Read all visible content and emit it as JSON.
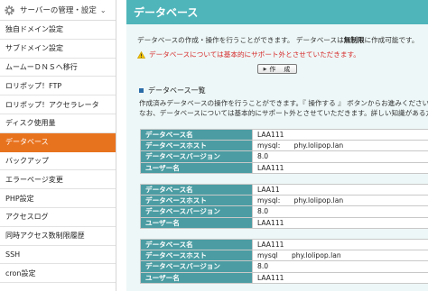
{
  "sidebar": {
    "header_title": "サーバーの管理・設定",
    "items": [
      {
        "label": "独自ドメイン設定"
      },
      {
        "label": "サブドメイン設定"
      },
      {
        "label": "ムームーＤＮＳへ移行"
      },
      {
        "label": "ロリポップ！FTP"
      },
      {
        "label": "ロリポップ！アクセラレータ"
      },
      {
        "label": "ディスク使用量"
      },
      {
        "label": "データベース",
        "active": true
      },
      {
        "label": "バックアップ"
      },
      {
        "label": "エラーページ変更"
      },
      {
        "label": "PHP設定"
      },
      {
        "label": "アクセスログ"
      },
      {
        "label": "同時アクセス数制限履歴"
      },
      {
        "label": "SSH"
      },
      {
        "label": "cron設定"
      }
    ]
  },
  "main": {
    "title": "データベース",
    "description_prefix": "データベースの作成・操作を行うことができます。 データベースは",
    "description_bold": "無制限",
    "description_suffix": "に作成可能です。",
    "warning": "データベースについては基本的にサポート外とさせていただきます。",
    "create_button": "作　成",
    "section_title": "データベース一覧",
    "section_desc_line1": "作成済みデータベースの操作を行うことができます。『 操作する 』 ボタンからお進みください。",
    "section_desc_line2": "なお、データベースについては基本的にサポート外とさせていただきます。詳しい知識がある方のみご利用ください。",
    "databases": [
      {
        "name_label": "データベース名",
        "name": "LAA111",
        "host_label": "データベースホスト",
        "host": "mysql:　　phy.lolipop.lan",
        "version_label": "データベースバージョン",
        "version": "8.0",
        "user_label": "ユーザー名",
        "user": "LAA111"
      },
      {
        "name_label": "データベース名",
        "name": "LAA11",
        "host_label": "データベースホスト",
        "host": "mysql:　　phy.lolipop.lan",
        "version_label": "データベースバージョン",
        "version": "8.0",
        "user_label": "ユーザー名",
        "user": "LAA111"
      },
      {
        "name_label": "データベース名",
        "name": "LAA111",
        "host_label": "データベースホスト",
        "host": "mysql　　phy.lolipop.lan",
        "version_label": "データベースバージョン",
        "version": "8.0",
        "user_label": "ユーザー名",
        "user": "LAA111"
      }
    ]
  },
  "colors": {
    "accent_active": "#e8731f",
    "header_teal": "#4fb5ba",
    "label_teal": "#4b9da3",
    "warning_red": "#d62b2b"
  }
}
